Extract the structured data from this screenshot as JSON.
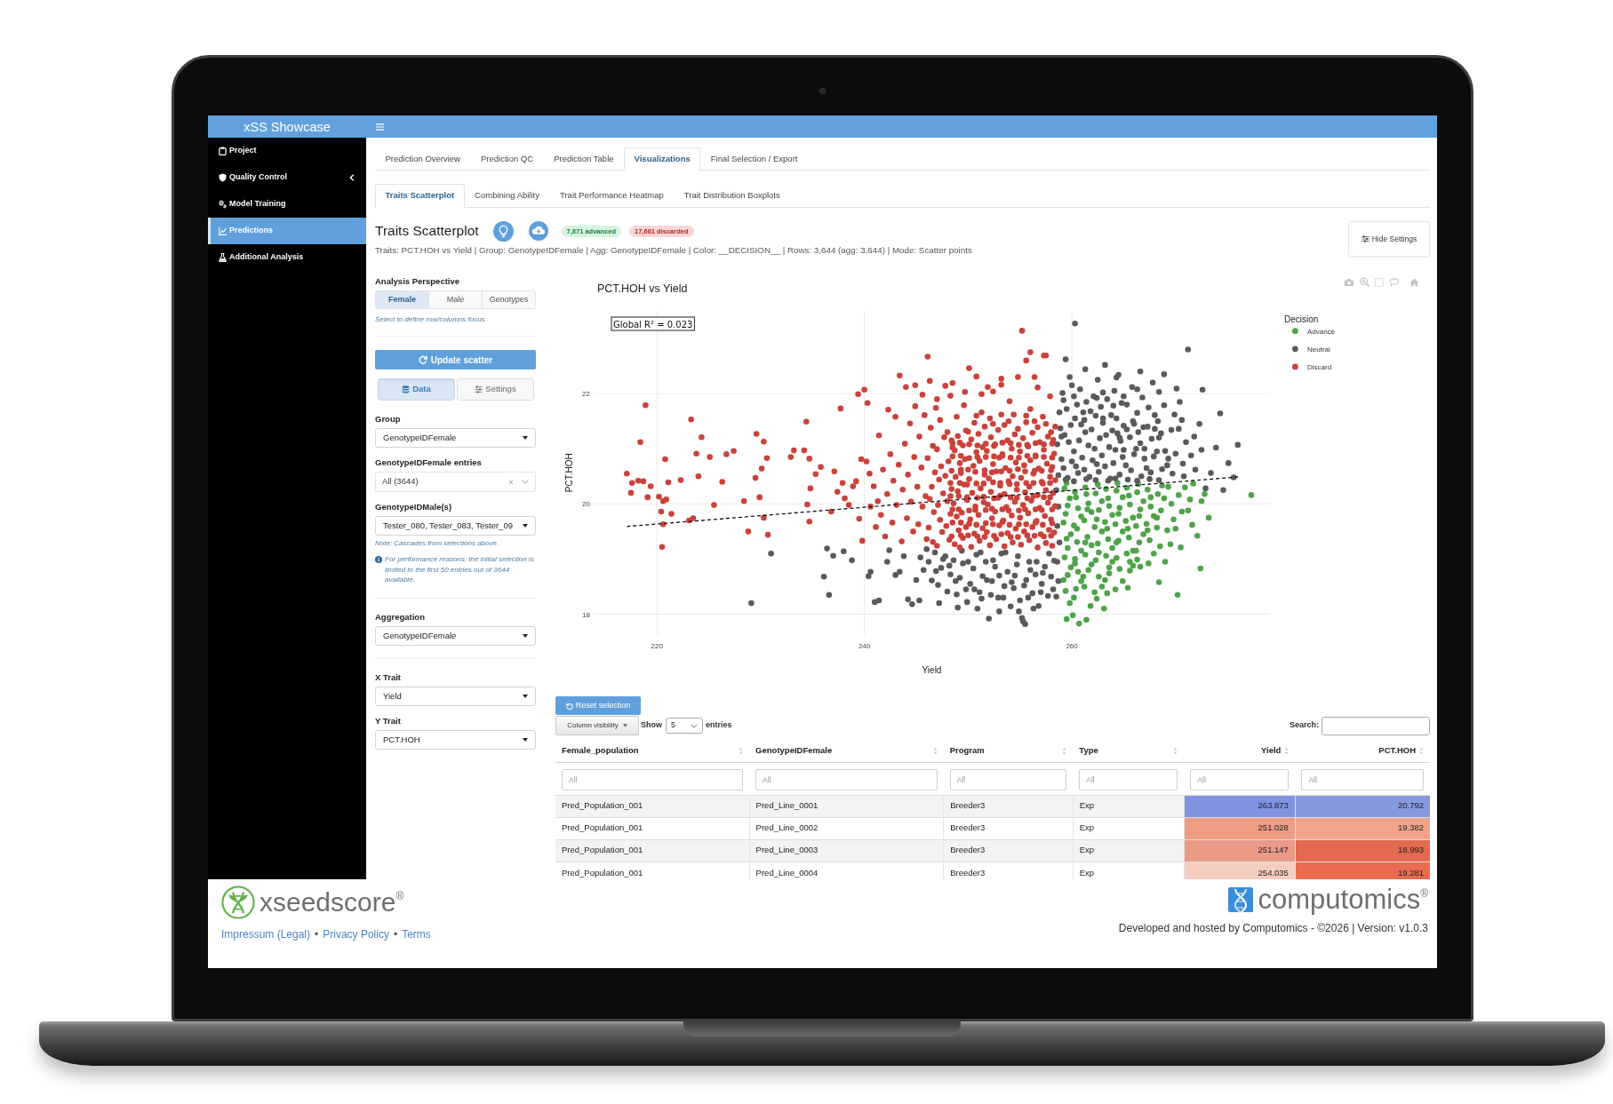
{
  "header": {
    "title": "xSS Showcase"
  },
  "sidebar": {
    "items": [
      {
        "label": "Project",
        "kind": "link",
        "selected": false
      },
      {
        "label": "Quality Control",
        "kind": "treeview",
        "selected": false
      },
      {
        "label": "Model Training",
        "kind": "link",
        "selected": false
      },
      {
        "label": "Predictions",
        "kind": "link",
        "selected": true
      },
      {
        "label": "Additional Analysis",
        "kind": "link",
        "selected": false
      }
    ]
  },
  "tabs": [
    {
      "label": "Prediction Overview",
      "selected": false
    },
    {
      "label": "Prediction QC",
      "selected": false
    },
    {
      "label": "Prediction Table",
      "selected": false
    },
    {
      "label": "Visualizations",
      "selected": true
    },
    {
      "label": "Final Selection / Export",
      "selected": false
    }
  ],
  "subtabs": [
    {
      "label": "Traits Scatterplot",
      "selected": true
    },
    {
      "label": "Combining Ability",
      "selected": false
    },
    {
      "label": "Trait Performance Heatmap",
      "selected": false
    },
    {
      "label": "Trait Distribution Boxplots",
      "selected": false
    }
  ],
  "panel": {
    "title": "Traits Scatterplot",
    "badges": [
      {
        "text": "7,871 advanced",
        "kind": "success"
      },
      {
        "text": "17,661 discarded",
        "kind": "danger"
      }
    ],
    "summary": "Traits: PCT.HOH vs Yield | Group: GenotypeIDFemale | Agg: GenotypeIDFemale | Color: __DECISION__ | Rows: 3,644 (agg: 3,644) | Mode: Scatter points",
    "settings_button": "Hide Settings"
  },
  "settings": {
    "perspective": {
      "label": "Analysis Perspective",
      "options": [
        {
          "label": "Female",
          "selected": true
        },
        {
          "label": "Male",
          "selected": false
        },
        {
          "label": "Genotypes",
          "selected": false
        }
      ],
      "hint": "Select to define row/columns focus."
    },
    "update_button": "Update scatter",
    "view_tabs": [
      {
        "label": "Data",
        "selected": true
      },
      {
        "label": "Settings",
        "selected": false
      }
    ],
    "sections": [
      {
        "fields": [
          {
            "label": "Group",
            "kind": "select",
            "value": "GenotypeIDFemale"
          },
          {
            "label": "GenotypeIDFemale entries",
            "kind": "multiselect",
            "value": "All (3644)"
          },
          {
            "label": "GenotypeIDMale(s)",
            "kind": "select",
            "value": "Tester_080, Tester_083, Tester_09",
            "note": "Note: Cascades from selections above.",
            "info": "For performance reasons, the initial selection is limited to the first 50 entries out of 3644 available."
          }
        ]
      },
      {
        "fields": [
          {
            "label": "Aggregation",
            "kind": "select",
            "value": "GenotypeIDFemale"
          }
        ]
      },
      {
        "fields": [
          {
            "label": "X Trait",
            "kind": "select",
            "value": "Yield"
          },
          {
            "label": "Y Trait",
            "kind": "select",
            "value": "PCT.HOH"
          }
        ]
      }
    ]
  },
  "chart": {
    "chart_data": {
      "type": "scatter",
      "title": "PCT.HOH vs Yield",
      "xlabel": "Yield",
      "ylabel": "PCT.HOH",
      "xlim": [
        213.9,
        279.1
      ],
      "ylim": [
        17.63,
        23.5
      ],
      "xticks": [
        220,
        240,
        260
      ],
      "yticks": [
        18,
        20,
        22
      ],
      "grid": true,
      "legend": {
        "title": "Decision"
      },
      "series": [
        {
          "name": "Advance",
          "color": "#4fa34a",
          "x": [
            259.3,
            259.6,
            259.2,
            259.5,
            259.3,
            259.6,
            259.4,
            259.5,
            260.3,
            260.6,
            260.2,
            260.5,
            260.3,
            260.6,
            260.4,
            260.1,
            260.7,
            261.3,
            261.6,
            261.2,
            261.5,
            261.3,
            261.6,
            261.2,
            261.4,
            262.3,
            262.6,
            262.2,
            262.5,
            262.3,
            262.6,
            262.4,
            263.3,
            263.6,
            263.2,
            263.5,
            263.3,
            263.6,
            263.4,
            264.3,
            264.6,
            264.2,
            264.5,
            264.3,
            264.6,
            265.3,
            265.6,
            265.2,
            265.5,
            265.3,
            265.6,
            265.4,
            266.3,
            266.6,
            266.2,
            266.5,
            266.3,
            266.6,
            267.3,
            267.6,
            267.2,
            267.5,
            267.4,
            268.3,
            268.6,
            268.2,
            268.5,
            268.4,
            269.3,
            269.6,
            269.2,
            269.5,
            270.3,
            270.6,
            270.5,
            270.2,
            271.4,
            271.6,
            272.1,
            272.4,
            271.7,
            272.8,
            277.3,
            273.2,
            259.8,
            260.9,
            261.9,
            262.9,
            263.9,
            264.9,
            265.9,
            266.9,
            267.9,
            268.9,
            259.9,
            260.9,
            261.9,
            262.9,
            263.9,
            264.9,
            265.9,
            266.9,
            267.9,
            259.9,
            260.9,
            261.9,
            262.9,
            263.9,
            264.9,
            265.9,
            259.8,
            261.8,
            263.1,
            259.5,
            260.4,
            261.4,
            262.5,
            263.5,
            264.4,
            265.5,
            266.4,
            267.6,
            268.7,
            259.4,
            260.5,
            261.5,
            262.4,
            263.4,
            264.5,
            265.4,
            266.5,
            267.3,
            268.2,
            259.6,
            260.3,
            261.3,
            262.6,
            263.6,
            264.3,
            265.6,
            266.2,
            259.2,
            260.2,
            261.1,
            262.2,
            263.2,
            264.2,
            269.8,
            270.9,
            271.2,
            269.0,
            270.0,
            272.5
          ],
          "values": [
            20.28,
            19.97,
            19.66,
            19.37,
            19.03,
            18.71,
            18.42,
            17.91,
            20.22,
            19.92,
            19.61,
            19.31,
            19.0,
            18.77,
            18.46,
            17.98,
            17.83,
            20.3,
            20.01,
            19.7,
            19.4,
            19.08,
            18.8,
            18.5,
            17.9,
            20.19,
            19.89,
            19.58,
            19.28,
            18.98,
            18.68,
            18.28,
            20.27,
            19.96,
            19.67,
            19.36,
            19.06,
            18.74,
            18.38,
            20.24,
            19.93,
            19.63,
            19.33,
            19.02,
            18.82,
            20.29,
            19.99,
            19.69,
            19.39,
            19.1,
            18.79,
            18.48,
            20.21,
            19.9,
            19.6,
            19.3,
            18.99,
            18.86,
            20.26,
            19.95,
            19.64,
            19.34,
            18.92,
            20.18,
            19.88,
            19.57,
            19.23,
            18.58,
            20.31,
            20.0,
            19.52,
            19.27,
            20.16,
            19.86,
            19.21,
            18.35,
            20.08,
            19.62,
            19.42,
            18.83,
            20.37,
            20.18,
            20.16,
            19.75,
            20.1,
            19.77,
            19.85,
            20.05,
            19.8,
            20.12,
            19.75,
            20.05,
            19.78,
            20.1,
            19.45,
            19.15,
            19.25,
            19.5,
            19.2,
            19.5,
            19.15,
            19.45,
            19.1,
            18.85,
            18.6,
            18.9,
            18.5,
            18.95,
            18.6,
            18.88,
            18.2,
            18.15,
            18.1,
            20.38,
            20.12,
            20.18,
            20.35,
            20.1,
            20.38,
            20.15,
            20.36,
            20.12,
            20.33,
            19.82,
            19.55,
            19.9,
            19.72,
            19.55,
            19.82,
            19.55,
            19.78,
            19.52,
            19.75,
            19.2,
            18.92,
            19.3,
            19.12,
            18.85,
            19.3,
            18.95,
            19.15,
            18.62,
            18.3,
            18.68,
            18.4,
            18.62,
            18.45,
            19.72,
            20.3,
            19.88,
            18.95,
            19.55,
            20.05
          ]
        },
        {
          "name": "Neutral",
          "color": "#5a5a5a",
          "x": [
            258.7,
            259.0,
            258.6,
            258.9,
            258.8,
            259.1,
            259.6,
            260.0,
            259.7,
            259.9,
            259.5,
            259.8,
            260.6,
            261.0,
            260.7,
            260.9,
            260.5,
            260.8,
            261.7,
            262.0,
            261.6,
            261.9,
            261.8,
            262.1,
            262.6,
            262.9,
            262.7,
            263.0,
            262.8,
            262.5,
            263.7,
            264.0,
            263.6,
            263.9,
            263.8,
            264.1,
            264.6,
            264.9,
            264.7,
            265.0,
            264.8,
            264.5,
            265.7,
            266.0,
            265.6,
            265.9,
            265.8,
            266.7,
            267.0,
            266.6,
            266.9,
            266.8,
            267.6,
            267.9,
            267.7,
            268.0,
            267.8,
            268.7,
            269.0,
            268.6,
            268.9,
            269.7,
            270.0,
            269.6,
            270.1,
            270.7,
            271.0,
            270.6,
            271.2,
            271.9,
            272.3,
            272.5,
            273.4,
            273.9,
            274.3,
            275.1,
            275.6,
            276.0,
            272.9,
            274.6,
            259.4,
            260.3,
            261.3,
            263.2,
            264.3,
            266.3,
            268.4,
            272.6,
            259.2,
            260.2,
            261.2,
            262.2,
            263.2,
            264.2,
            265.2,
            266.2,
            267.2,
            268.2,
            269.2,
            259.3,
            260.3,
            261.3,
            262.3,
            263.3,
            264.3,
            265.3,
            266.3,
            267.3,
            268.3,
            260.2,
            261.4,
            263.4,
            265.3,
            258.6,
            258.7,
            258.5,
            258.8,
            258.6,
            258.7,
            258.5,
            236.1,
            236.6,
            236.4,
            237.0,
            238.0,
            238.8,
            229.1,
            231.0,
            240.4,
            240.6,
            241.0,
            241.4,
            242.2,
            242.4,
            243.0,
            243.4,
            243.8,
            244.2,
            244.6,
            245.0,
            245.3,
            245.4,
            245.7,
            246.2,
            246.5,
            246.8,
            247.1,
            247.4,
            247.8,
            248.0,
            248.3,
            248.6,
            248.9,
            249.2,
            249.5,
            249.9,
            250.2,
            250.5,
            250.8,
            251.1,
            251.4,
            251.7,
            252.0,
            252.3,
            252.6,
            252.9,
            253.2,
            253.5,
            253.8,
            254.1,
            254.4,
            254.7,
            255.0,
            255.2,
            255.3,
            255.5,
            255.6,
            255.9,
            256.2,
            256.5,
            256.8,
            257.1,
            257.4,
            257.7,
            258.0,
            258.3,
            254.9,
            251.3,
            249.0,
            253.0,
            259.4,
            260.2,
            261.4,
            262.3,
            263.5,
            264.2,
            265.4,
            266.3,
            267.5,
            268.4,
            259.0,
            260.4,
            261.1,
            262.4,
            263.0,
            264.4,
            265.0,
            266.4,
            267.0,
            268.4,
            259.2,
            260.0,
            261.2,
            262.4,
            263.0,
            264.0,
            265.0,
            266.0,
            267.4,
            268.0,
            269.3,
            270.3,
            269.9,
            270.8,
            271.5,
            268.9,
            270.4,
            271.8,
            266.6,
            264.6,
            246.0,
            246.9,
            247.6,
            248.2,
            248.8,
            249.4,
            250.0,
            250.6,
            251.2,
            251.8,
            252.4,
            253.0,
            253.6,
            254.2,
            254.8,
            255.4,
            256.0,
            256.6,
            257.2,
            257.8,
            247.2,
            249.8,
            252.2,
            254.5,
            256.3,
            258.2,
            250.9,
            253.4,
            255.8,
            257.0
          ],
          "values": [
            20.52,
            20.81,
            21.08,
            21.37,
            21.66,
            22.01,
            20.47,
            20.77,
            21.12,
            21.43,
            21.72,
            22.3,
            20.56,
            20.84,
            21.15,
            21.44,
            21.8,
            22.08,
            20.49,
            20.79,
            21.06,
            21.35,
            21.68,
            21.95,
            20.58,
            20.88,
            21.19,
            21.47,
            21.76,
            22.25,
            20.46,
            20.74,
            21.03,
            21.33,
            21.61,
            22.05,
            20.53,
            20.85,
            21.14,
            21.42,
            21.83,
            22.34,
            20.61,
            20.9,
            21.21,
            21.5,
            22.12,
            20.5,
            20.82,
            21.1,
            21.39,
            21.93,
            20.57,
            20.86,
            21.18,
            21.61,
            22.2,
            20.63,
            20.96,
            21.28,
            21.79,
            20.55,
            20.91,
            21.34,
            22.09,
            20.73,
            21.12,
            21.52,
            22.8,
            20.62,
            21.45,
            20.98,
            20.56,
            21.02,
            21.64,
            20.74,
            20.48,
            21.07,
            20.28,
            20.25,
            22.62,
            23.27,
            22.44,
            22.52,
            22.29,
            22.08,
            22.03,
            22.07,
            20.65,
            20.95,
            20.62,
            21.0,
            20.68,
            20.98,
            20.7,
            21.0,
            20.65,
            20.95,
            20.7,
            21.25,
            21.55,
            21.3,
            21.6,
            21.25,
            21.55,
            21.35,
            21.65,
            21.4,
            21.5,
            21.95,
            21.85,
            21.9,
            21.8,
            19.6,
            19.95,
            20.25,
            19.3,
            18.95,
            18.6,
            18.32,
            18.68,
            18.35,
            19.19,
            19.06,
            19.14,
            18.98,
            18.2,
            19.1,
            18.69,
            18.77,
            18.22,
            18.25,
            18.95,
            19.16,
            18.71,
            18.77,
            19.05,
            18.27,
            18.18,
            18.62,
            18.25,
            19.03,
            18.8,
            18.95,
            18.61,
            19.12,
            18.53,
            18.84,
            19.05,
            18.41,
            18.72,
            18.98,
            18.36,
            18.66,
            18.92,
            18.22,
            18.55,
            18.83,
            19.08,
            18.4,
            18.69,
            18.95,
            17.92,
            18.6,
            18.86,
            18.3,
            19.1,
            18.51,
            18.77,
            18.14,
            18.47,
            18.9,
            18.25,
            17.93,
            17.87,
            17.82,
            18.62,
            18.95,
            18.38,
            18.72,
            18.15,
            18.55,
            18.86,
            18.33,
            18.68,
            18.97,
            18.05,
            18.28,
            18.12,
            18.05,
            20.44,
            20.41,
            20.45,
            20.43,
            20.42,
            20.46,
            20.44,
            20.42,
            20.45,
            20.43,
            21.22,
            20.68,
            21.66,
            20.72,
            21.55,
            21.28,
            20.98,
            21.3,
            21.0,
            21.2,
            21.88,
            22.15,
            21.52,
            21.92,
            22.02,
            21.78,
            21.95,
            21.45,
            21.75,
            21.36,
            20.82,
            21.36,
            21.62,
            20.5,
            20.88,
            22.35,
            21.85,
            21.22,
            22.4,
            21.2,
            19.18,
            18.78,
            19.0,
            18.88,
            18.6,
            19.15,
            18.95,
            18.45,
            19.12,
            18.62,
            18.98,
            18.7,
            19.12,
            18.58,
            19.05,
            18.52,
            18.8,
            18.95,
            18.75,
            19.1,
            18.2,
            18.45,
            18.35,
            18.7,
            18.1,
            18.45,
            18.1,
            18.3,
            18.3,
            18.4
          ]
        },
        {
          "name": "Discard",
          "color": "#c9423b",
          "x": [
            217.1,
            217.5,
            217.6,
            218.2,
            218.4,
            218.9,
            218.7,
            219.1,
            219.4,
            220.2,
            220.4,
            220.6,
            220.8,
            220.9,
            221.1,
            220.6,
            220.5,
            221.4,
            222.3,
            223.1,
            223.3,
            223.8,
            223.5,
            224.3,
            224.0,
            225.1,
            225.5,
            226.3,
            226.7,
            227.4,
            228.4,
            228.8,
            229.5,
            229.6,
            229.9,
            230.1,
            230.3,
            230.3,
            230.6,
            230.7,
            232.9,
            233.2,
            234.2,
            234.4,
            234.5,
            234.7,
            234.8,
            234.7,
            235.3,
            235.8,
            236.8,
            237.1,
            237.4,
            237.7,
            237.9,
            238.1,
            238.5,
            238.9,
            239.2,
            239.5,
            239.4,
            239.7,
            239.8,
            240.0,
            240.3,
            240.2,
            240.5,
            240.6,
            240.9,
            241.1,
            241.3,
            241.4,
            241.6,
            241.8,
            242.0,
            242.2,
            242.3,
            242.5,
            242.7,
            242.8,
            243.0,
            243.1,
            243.3,
            243.4,
            243.6,
            243.7,
            243.9,
            244.0,
            244.1,
            244.2,
            244.4,
            244.5,
            244.7,
            244.8,
            244.9,
            245.1,
            245.2,
            245.3,
            245.5,
            245.6,
            245.8,
            245.9,
            246.0,
            246.6,
            246.2,
            246.7,
            246.3,
            246.5,
            246.8,
            246.1,
            246.6,
            246.4,
            246.9,
            247.0,
            247.5,
            247.3,
            247.1,
            247.6,
            247.2,
            247.4,
            247.0,
            247.7,
            247.3,
            248.2,
            247.9,
            248.3,
            248.0,
            248.4,
            247.8,
            248.1,
            248.5,
            248.0,
            248.3,
            248.7,
            249.1,
            248.9,
            248.6,
            249.0,
            248.8,
            249.2,
            248.7,
            249.0,
            248.9,
            249.5,
            249.8,
            249.4,
            249.9,
            249.6,
            249.3,
            249.7,
            249.5,
            249.8,
            249.6,
            250.3,
            250.6,
            250.2,
            250.7,
            250.4,
            250.1,
            250.5,
            250.8,
            250.3,
            250.6,
            251.1,
            251.4,
            251.0,
            251.5,
            251.2,
            251.6,
            251.1,
            251.4,
            251.0,
            251.3,
            252.1,
            251.8,
            252.3,
            251.9,
            252.2,
            252.0,
            252.4,
            251.8,
            252.2,
            252.1,
            252.7,
            253.0,
            252.6,
            252.9,
            253.1,
            252.7,
            253.0,
            252.6,
            252.9,
            253.2,
            253.5,
            253.8,
            253.4,
            253.7,
            253.5,
            253.9,
            253.6,
            253.3,
            253.8,
            253.5,
            254.3,
            254.6,
            254.2,
            254.5,
            254.7,
            254.3,
            254.6,
            254.2,
            254.5,
            254.4,
            255.1,
            255.4,
            255.0,
            255.3,
            255.5,
            255.1,
            255.4,
            255.0,
            255.3,
            255.6,
            255.9,
            256.2,
            255.8,
            256.1,
            255.9,
            256.3,
            256.0,
            255.8,
            256.2,
            256.0,
            256.7,
            257.0,
            256.6,
            256.9,
            256.7,
            257.1,
            256.8,
            256.5,
            256.9,
            256.7,
            257.5,
            257.8,
            257.4,
            257.7,
            257.5,
            257.9,
            257.6,
            257.3,
            257.7,
            257.5,
            258.1,
            258.3,
            258.0,
            258.4,
            258.2,
            258.4,
            258.1,
            258.3,
            258.2,
            258.4,
            248.4,
            248.5,
            248.3,
            248.5,
            248.4,
            249.2,
            249.3,
            249.1,
            249.3,
            249.2,
            250.0,
            250.1,
            249.9,
            250.1,
            250.0,
            250.8,
            250.9,
            250.7,
            250.9,
            250.8,
            251.6,
            251.7,
            251.5,
            251.7,
            251.6,
            252.4,
            252.5,
            252.3,
            252.5,
            252.4,
            253.2,
            253.3,
            253.1,
            253.3,
            253.2,
            254.0,
            254.1,
            254.0,
            254.1,
            253.9,
            254.8,
            254.9,
            254.7,
            254.9,
            254.8,
            255.6,
            255.7,
            255.5,
            255.7,
            255.6,
            256.4,
            256.5,
            256.3,
            256.5,
            256.4,
            257.2,
            257.3,
            257.1,
            257.3,
            257.2,
            258.0,
            258.1,
            257.9,
            258.1,
            258.0,
            244.9,
            245.6,
            246.3,
            247.0,
            247.8,
            248.5,
            249.7,
            250.8,
            251.3,
            251.9,
            252.4,
            253.2,
            254.0,
            254.8,
            255.2,
            255.6,
            256.0,
            256.4,
            256.7,
            257.3,
            257.5,
            257.9,
            246.1,
            250.1,
            248.5,
            248.3,
            248.4,
            248.5,
            250.1,
            249.9,
            250.0,
            250.1,
            251.7,
            251.5,
            251.6,
            251.7,
            253.3,
            253.1,
            253.2,
            253.3,
            254.9,
            254.7,
            254.8,
            254.9,
            256.5,
            256.3,
            256.4,
            256.5,
            258.1,
            257.9,
            258.0,
            258.1,
            249.3,
            249.1,
            249.2,
            249.3,
            250.9,
            250.7,
            250.8,
            250.9,
            252.5,
            252.3,
            252.4,
            252.5,
            254.1,
            253.9,
            254.0,
            254.1,
            255.7,
            255.5,
            255.6,
            255.7,
            257.3,
            257.1,
            257.2,
            257.3
          ],
          "values": [
            20.55,
            20.2,
            20.38,
            20.42,
            21.12,
            21.79,
            20.41,
            20.12,
            20.32,
            20.13,
            19.86,
            20.05,
            20.81,
            20.08,
            20.39,
            19.63,
            19.22,
            19.82,
            20.43,
            19.7,
            21.53,
            20.91,
            19.74,
            21.21,
            20.5,
            20.85,
            19.98,
            20.4,
            20.9,
            20.96,
            20.05,
            19.5,
            20.47,
            21.27,
            20.12,
            20.64,
            21.13,
            19.75,
            20.83,
            19.44,
            20.85,
            20.97,
            20.97,
            21.49,
            19.99,
            20.82,
            20.28,
            19.68,
            20.54,
            20.67,
            19.86,
            20.59,
            20.22,
            21.73,
            20.38,
            20.1,
            19.98,
            20.32,
            20.41,
            19.73,
            21.99,
            20.81,
            19.33,
            22.07,
            21.83,
            20.77,
            20.55,
            19.95,
            20.32,
            19.58,
            20.05,
            21.24,
            19.8,
            20.62,
            19.41,
            20.18,
            21.71,
            20.9,
            19.66,
            20.42,
            21.58,
            19.98,
            20.71,
            22.33,
            19.32,
            20.26,
            21.09,
            22.12,
            19.74,
            20.53,
            21.46,
            20.04,
            19.5,
            20.85,
            21.77,
            20.31,
            19.63,
            21.22,
            20.66,
            19.95,
            21.61,
            20.14,
            19.36,
            19.31,
            19.57,
            19.85,
            20.09,
            20.31,
            20.57,
            20.83,
            21.05,
            21.38,
            21.74,
            19.24,
            19.49,
            19.71,
            19.98,
            20.19,
            20.44,
            20.68,
            20.99,
            21.21,
            21.52,
            19.35,
            19.6,
            19.82,
            20.05,
            20.27,
            20.51,
            20.77,
            21.02,
            21.3,
            21.96,
            19.27,
            19.52,
            19.77,
            20.01,
            20.23,
            20.49,
            20.74,
            20.97,
            21.23,
            21.58,
            19.38,
            19.58,
            19.84,
            20.07,
            20.35,
            20.56,
            20.81,
            21.06,
            21.33,
            21.79,
            19.22,
            19.46,
            19.72,
            19.95,
            20.2,
            20.45,
            20.69,
            20.94,
            21.17,
            21.47,
            19.33,
            19.56,
            19.8,
            20.03,
            20.28,
            20.53,
            20.78,
            21.03,
            21.27,
            21.66,
            19.25,
            19.49,
            19.74,
            19.99,
            20.22,
            20.46,
            20.72,
            20.96,
            21.21,
            21.55,
            19.36,
            19.61,
            19.86,
            20.11,
            20.33,
            20.59,
            20.84,
            21.08,
            21.34,
            22.16,
            19.23,
            19.47,
            19.7,
            19.94,
            20.18,
            20.41,
            20.65,
            20.9,
            21.15,
            21.43,
            19.3,
            19.55,
            19.79,
            20.04,
            20.26,
            20.5,
            20.75,
            21.0,
            21.26,
            21.62,
            19.26,
            19.5,
            19.75,
            19.98,
            20.21,
            20.47,
            20.7,
            20.95,
            21.19,
            21.48,
            19.34,
            19.58,
            19.83,
            20.06,
            20.31,
            20.55,
            20.79,
            21.04,
            21.29,
            21.72,
            19.21,
            19.45,
            19.69,
            19.93,
            20.16,
            20.4,
            20.64,
            20.88,
            21.12,
            21.39,
            19.29,
            19.53,
            19.78,
            20.02,
            20.25,
            20.49,
            20.73,
            20.98,
            21.22,
            21.45,
            19.24,
            19.48,
            19.72,
            19.96,
            20.2,
            20.43,
            20.67,
            20.91,
            21.16,
            21.4,
            19.41,
            19.9,
            20.38,
            20.86,
            21.15,
            19.21,
            19.66,
            20.14,
            20.62,
            21.11,
            19.43,
            19.88,
            20.35,
            20.83,
            21.31,
            19.62,
            20.11,
            20.58,
            21.06,
            21.6,
            19.4,
            19.89,
            20.37,
            20.85,
            21.4,
            19.63,
            20.1,
            20.57,
            21.05,
            21.45,
            19.45,
            19.9,
            20.38,
            20.87,
            21.62,
            19.62,
            20.12,
            20.6,
            21.1,
            21.5,
            19.4,
            19.88,
            20.36,
            20.84,
            21.36,
            19.63,
            20.1,
            20.59,
            21.07,
            21.6,
            19.42,
            19.9,
            20.38,
            20.86,
            21.5,
            19.62,
            20.12,
            20.6,
            21.08,
            21.58,
            19.42,
            19.9,
            20.38,
            20.84,
            21.3,
            22.15,
            21.98,
            22.23,
            21.9,
            22.14,
            22.19,
            22.03,
            22.31,
            21.99,
            22.12,
            22.04,
            22.27,
            21.86,
            22.3,
            23.14,
            22.6,
            22.75,
            22.3,
            22.11,
            22.69,
            22.69,
            21.95,
            22.67,
            22.46,
            19.66,
            20.14,
            20.6,
            21.1,
            19.64,
            20.12,
            20.62,
            21.08,
            19.65,
            20.13,
            20.61,
            21.09,
            19.67,
            20.15,
            20.59,
            21.11,
            19.63,
            20.11,
            20.63,
            21.07,
            19.66,
            20.14,
            20.6,
            21.1,
            19.65,
            20.12,
            20.61,
            21.09,
            19.43,
            19.9,
            20.38,
            20.87,
            19.41,
            19.89,
            20.37,
            20.85,
            19.42,
            19.91,
            20.39,
            20.86,
            19.4,
            19.88,
            20.36,
            20.84,
            19.43,
            19.9,
            20.38,
            20.87,
            19.41,
            19.89,
            20.37,
            20.85
          ]
        },
        {
          "type": "line",
          "line_style": "dashed",
          "color": "#111111",
          "x": [
            217.1,
            276.1
          ],
          "values": [
            19.59,
            20.49
          ]
        }
      ],
      "annotations": [
        {
          "text": "Global R² = 0.023"
        }
      ]
    }
  },
  "table": {
    "reset_button": "Reset selection",
    "column_visibility_button": "Column visibility",
    "length": {
      "before": "Show",
      "value": "5",
      "after": "entries"
    },
    "search": {
      "label": "Search:"
    },
    "columns": [
      {
        "label": "Female_population",
        "kind": "text"
      },
      {
        "label": "GenotypeIDFemale",
        "kind": "text"
      },
      {
        "label": "Program",
        "kind": "text"
      },
      {
        "label": "Type",
        "kind": "text"
      },
      {
        "label": "Yield",
        "kind": "numeric"
      },
      {
        "label": "PCT.HOH",
        "kind": "numeric"
      }
    ],
    "filters": [
      {
        "placeholder": "All"
      },
      {
        "placeholder": "All"
      },
      {
        "placeholder": "All"
      },
      {
        "placeholder": "All"
      },
      {
        "placeholder": "All"
      },
      {
        "placeholder": "All"
      }
    ],
    "rows": [
      {
        "cells": [
          "Pred_Population_001",
          "Pred_Line_0001",
          "Breeder3",
          "Exp",
          {
            "text": "263.873",
            "color": "#7f93e0"
          },
          {
            "text": "20.792",
            "color": "#8699df"
          }
        ]
      },
      {
        "cells": [
          "Pred_Population_001",
          "Pred_Line_0002",
          "Breeder3",
          "Exp",
          {
            "text": "251.028",
            "color": "#ef9d85"
          },
          {
            "text": "19.382",
            "color": "#f1a48c"
          }
        ]
      },
      {
        "cells": [
          "Pred_Population_001",
          "Pred_Line_0003",
          "Breeder3",
          "Exp",
          {
            "text": "251.147",
            "color": "#ea9a85"
          },
          {
            "text": "18.993",
            "color": "#e46a4f"
          }
        ]
      },
      {
        "cells": [
          "Pred_Population_001",
          "Pred_Line_0004",
          "Breeder3",
          "Exp",
          {
            "text": "254.035",
            "color": "#f6cdc1"
          },
          {
            "text": "19.281",
            "color": "#e96c50"
          }
        ]
      }
    ]
  },
  "footer": {
    "brand": "xseedscore$^{®}$",
    "links": [
      {
        "kind": "link",
        "text": "Impressum (Legal)"
      },
      {
        "kind": "separator",
        "text": "•"
      },
      {
        "kind": "link",
        "text": "Privacy Policy"
      },
      {
        "kind": "separator",
        "text": "•"
      },
      {
        "kind": "link",
        "text": "Terms"
      }
    ],
    "partner": "computomics$^{®}$",
    "credit": "Developed and hosted by Computomics - ©2026 | Version: v1.0.3"
  }
}
